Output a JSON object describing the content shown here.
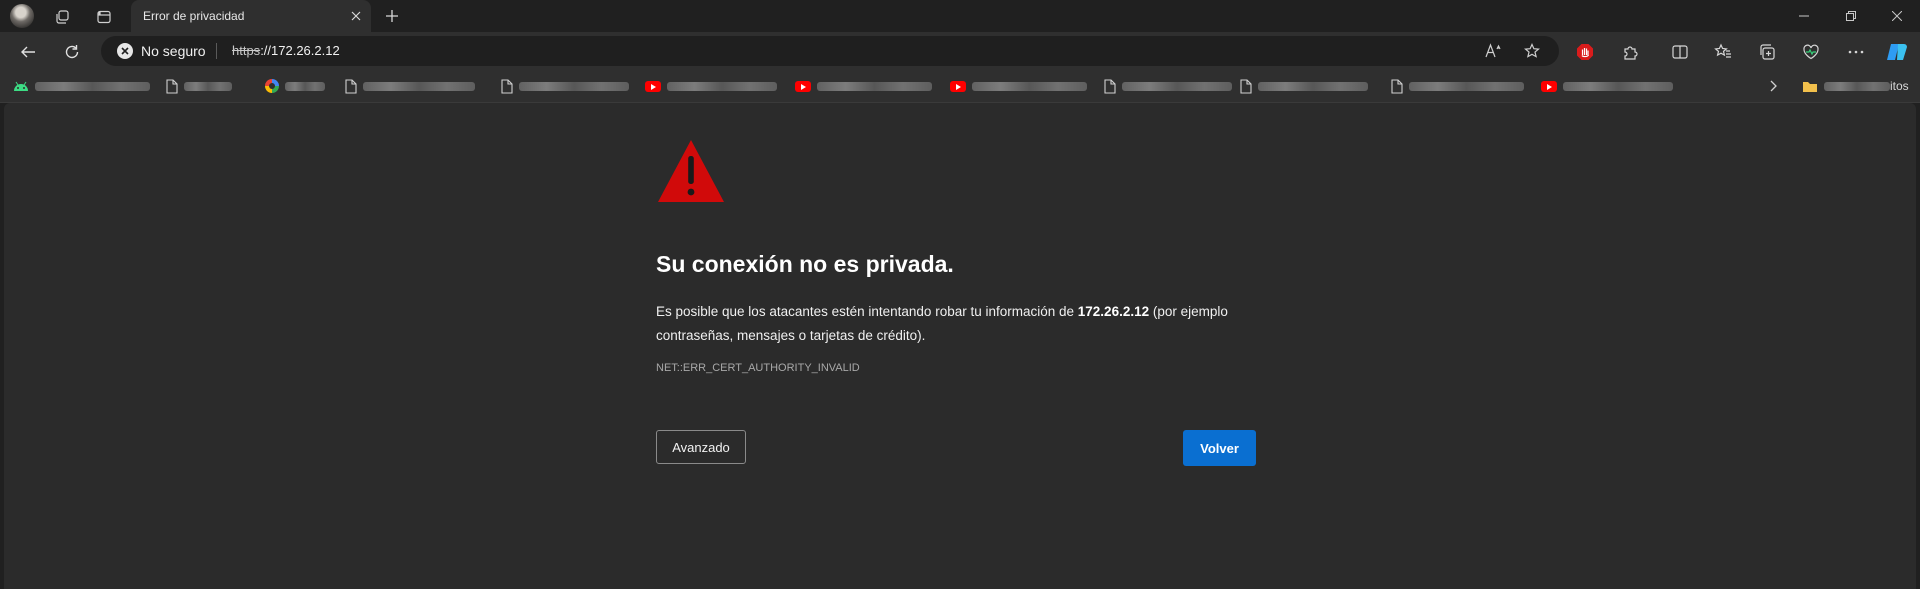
{
  "tab": {
    "title": "Error de privacidad"
  },
  "toolbar": {
    "security_label": "No seguro",
    "url_scheme": "https",
    "url_rest": "://172.26.2.12"
  },
  "bookmarks": {
    "favorites_tail": "itos"
  },
  "error": {
    "heading": "Su conexión no es privada.",
    "para_before": "Es posible que los atacantes estén intentando robar tu información de ",
    "host": "172.26.2.12",
    "para_after": " (por ejemplo contraseñas, mensajes o tarjetas de crédito).",
    "code": "NET::ERR_CERT_AUTHORITY_INVALID"
  },
  "buttons": {
    "advanced": "Avanzado",
    "back": "Volver"
  },
  "colors": {
    "warning_red": "#d10a0a",
    "primary_blue": "#0a6fd1"
  },
  "icons": {
    "tab_actions": "workspaces-icon",
    "vertical_tabs": "vertical-tabs-icon",
    "security": "not-secure-icon",
    "read_aloud": "read-aloud-icon",
    "favorite": "star-icon",
    "warning": "warning-triangle-icon"
  }
}
